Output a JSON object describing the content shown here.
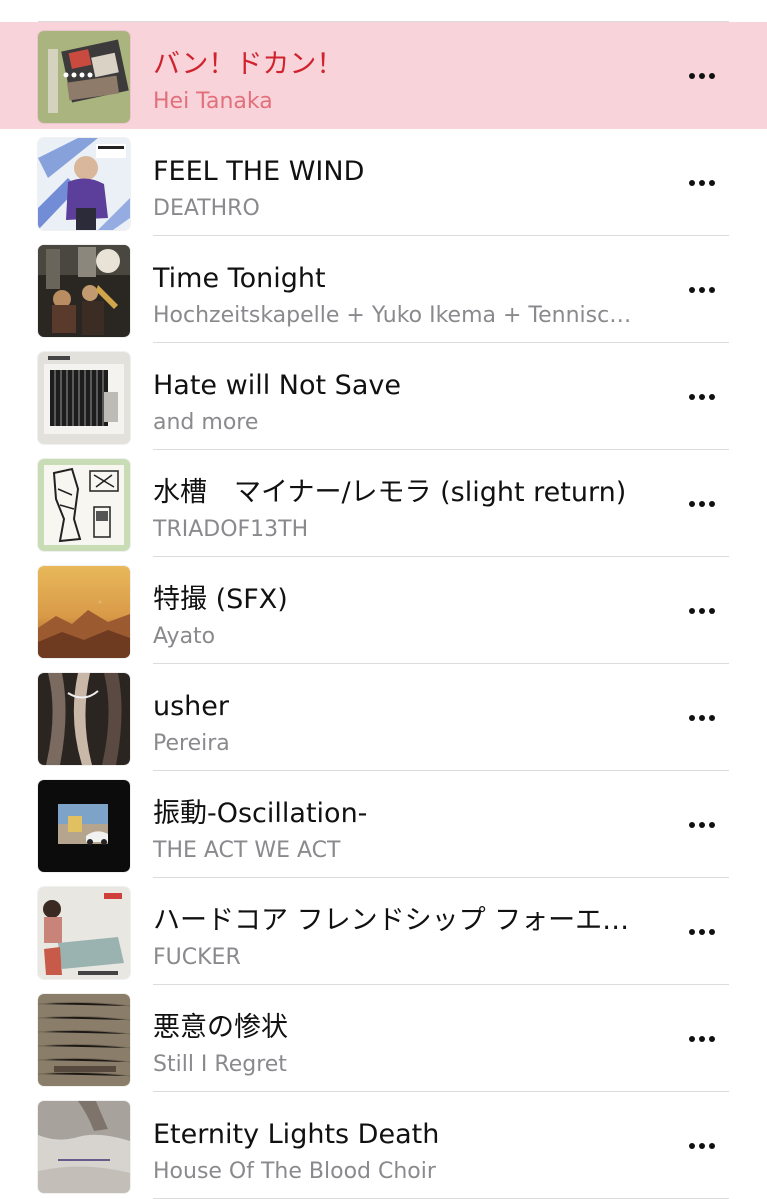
{
  "playlist": {
    "accent_color": "#d0232e",
    "playing_row_color": "#f8d3d9",
    "tracks": [
      {
        "title": "バン！ドカン！",
        "artist": "Hei Tanaka",
        "now_playing": true,
        "more_icon": "more-horizontal-icon"
      },
      {
        "title": "FEEL THE WIND",
        "artist": "DEATHRO",
        "now_playing": false,
        "more_icon": "more-horizontal-icon"
      },
      {
        "title": "Time Tonight",
        "artist": "Hochzeitskapelle + Yuko Ikema + Tennisc…",
        "now_playing": false,
        "more_icon": "more-horizontal-icon"
      },
      {
        "title": "Hate will Not Save",
        "artist": "and more",
        "now_playing": false,
        "more_icon": "more-horizontal-icon"
      },
      {
        "title": "水槽　マイナー/レモラ (slight return)",
        "artist": "TRIADOF13TH",
        "now_playing": false,
        "more_icon": "more-horizontal-icon"
      },
      {
        "title": "特撮 (SFX)",
        "artist": "Ayato",
        "now_playing": false,
        "more_icon": "more-horizontal-icon"
      },
      {
        "title": "usher",
        "artist": "Pereira",
        "now_playing": false,
        "more_icon": "more-horizontal-icon"
      },
      {
        "title": "振動-Oscillation-",
        "artist": "THE ACT WE ACT",
        "now_playing": false,
        "more_icon": "more-horizontal-icon"
      },
      {
        "title": "ハードコア フレンドシップ フォーエ…",
        "artist": "FUCKER",
        "now_playing": false,
        "more_icon": "more-horizontal-icon"
      },
      {
        "title": "悪意の惨状",
        "artist": "Still I Regret",
        "now_playing": false,
        "more_icon": "more-horizontal-icon"
      },
      {
        "title": "Eternity Lights Death",
        "artist": "House Of The Blood Choir",
        "now_playing": false,
        "more_icon": "more-horizontal-icon"
      }
    ]
  }
}
